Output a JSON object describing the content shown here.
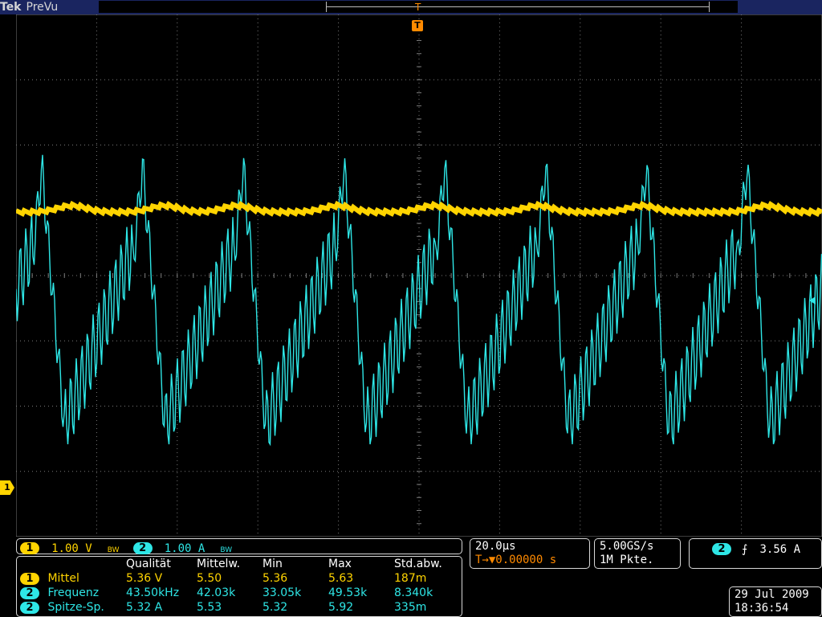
{
  "brand": {
    "name": "Tek",
    "mode": "PreVu"
  },
  "markers": {
    "trigger": "T",
    "ch1_ground": "1",
    "record_cursor": "T"
  },
  "colors": {
    "ch1": "#ffd400",
    "ch2": "#2ee6e6",
    "trigger": "#ff8a00",
    "grid": "#7a7a7a"
  },
  "channels": {
    "ch1": {
      "badge": "1",
      "scale": "1.00 V",
      "bw_flag": "BW"
    },
    "ch2": {
      "badge": "2",
      "scale": "1.00 A",
      "bw_flag": "BW"
    }
  },
  "timebase": {
    "scale": "20.0µs",
    "trigger_position": "T→▼0.00000 s"
  },
  "acquisition": {
    "sample_rate": "5.00GS/s",
    "record_length": "1M Pkte."
  },
  "trigger": {
    "source": "2",
    "slope_icon": "rising-edge",
    "level": "3.56 A"
  },
  "measurements": {
    "headers": [
      "Qualität",
      "Mittelw.",
      "Min",
      "Max",
      "Std.abw."
    ],
    "rows": [
      {
        "channel": "1",
        "name": "Mittel",
        "value": "5.36 V",
        "mean": "5.50",
        "min": "5.36",
        "max": "5.63",
        "std": "187m"
      },
      {
        "channel": "2",
        "name": "Frequenz",
        "value": "43.50kHz",
        "mean": "42.03k",
        "min": "33.05k",
        "max": "49.53k",
        "std": "8.340k"
      },
      {
        "channel": "2",
        "name": "Spitze-Sp.",
        "value": "5.32 A",
        "mean": "5.53",
        "min": "5.32",
        "max": "5.92",
        "std": "335m"
      }
    ]
  },
  "datetime": {
    "date": "29 Jul  2009",
    "time": "18:36:54"
  }
}
